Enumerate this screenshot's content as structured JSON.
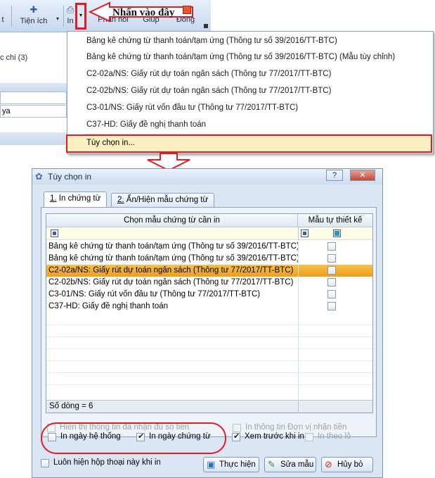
{
  "ribbon": {
    "partial_left": "t",
    "tien_ich": "Tiện ích",
    "in_label": "In",
    "phan_hoi": "Phản hồi",
    "giup": "Giúp",
    "dong": "Đóng",
    "callout": "Nhấn vào đây",
    "dropdown_arrow": "▾"
  },
  "left_pane": {
    "row1": "c chi (3)",
    "field_text": "ya"
  },
  "print_menu": {
    "items": [
      "Bảng kê chứng từ thanh toán/tạm ứng (Thông tư số 39/2016/TT-BTC)",
      "Bảng kê chứng từ thanh toán/tạm ứng (Thông tư số 39/2016/TT-BTC) (Mẫu tùy chỉnh)",
      "C2-02a/NS: Giấy rút dự toán ngân sách (Thông tư 77/2017/TT-BTC)",
      "C2-02b/NS: Giấy rút dự toán ngân sách (Thông tư 77/2017/TT-BTC)",
      "C3-01/NS: Giấy rút vốn đầu tư (Thông tư 77/2017/TT-BTC)",
      "C37-HD: Giấy đề nghị thanh toán"
    ],
    "options_item": "Tùy chọn in..."
  },
  "dialog": {
    "title": "Tùy chọn in",
    "help_btn": "?",
    "close_btn": "✕",
    "tabs": [
      {
        "num": "1.",
        "label": " In chứng từ"
      },
      {
        "num": "2.",
        "label": " Ẩn/Hiện mẫu chứng từ"
      }
    ],
    "grid": {
      "col_template": "Chọn mẫu chứng từ cần in",
      "col_custom": "Mẫu tự thiết kế",
      "rows": [
        {
          "name": "Bảng kê chứng từ thanh toán/tạm ứng (Thông tư số 39/2016/TT-BTC)",
          "selected": false
        },
        {
          "name": "Bảng kê chứng từ thanh toán/tạm ứng (Thông tư số 39/2016/TT-BTC)",
          "selected": false
        },
        {
          "name": "C2-02a/NS: Giấy rút dự toán ngân sách (Thông tư 77/2017/TT-BTC)",
          "selected": true
        },
        {
          "name": "C2-02b/NS: Giấy rút dự toán ngân sách (Thông tư 77/2017/TT-BTC)",
          "selected": false
        },
        {
          "name": "C3-01/NS: Giấy rút vốn đầu tư (Thông tư 77/2017/TT-BTC)",
          "selected": false
        },
        {
          "name": "C37-HD: Giấy đề nghị thanh toán",
          "selected": false
        }
      ],
      "row_count": "Số dòng = 6"
    },
    "options": {
      "show_paid_info": "Hiển thị thông tin đã nhận đủ số tiền",
      "print_recipient_info": "In thông tin Đơn vị nhận tiền",
      "print_system_date": "In ngày hệ thống",
      "print_voucher_date": "In ngày chứng từ",
      "preview_before_print": "Xem trước khi in",
      "print_by_batch": "In theo lô",
      "always_show": "Luôn hiện hộp thoại này khi in"
    },
    "buttons": {
      "execute": "Thực hiện",
      "edit_template": "Sửa mẫu",
      "cancel": "Hủy bỏ"
    }
  }
}
